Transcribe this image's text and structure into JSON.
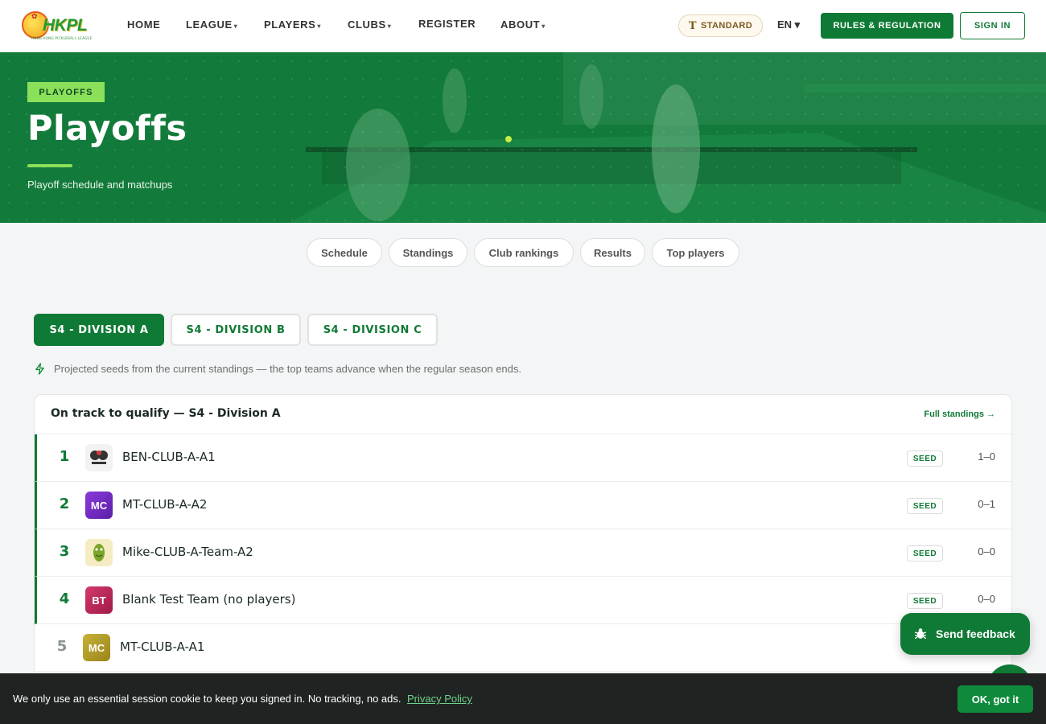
{
  "header": {
    "logo_text": "HKPL",
    "logo_sub": "HONG KONG PICKLEBALL LEAGUE",
    "nav": [
      {
        "label": "HOME",
        "caret": ""
      },
      {
        "label": "LEAGUE",
        "caret": "▾"
      },
      {
        "label": "PLAYERS",
        "caret": "▾"
      },
      {
        "label": "CLUBS",
        "caret": "▾"
      },
      {
        "label": "REGISTER",
        "caret": ""
      },
      {
        "label": "ABOUT",
        "caret": "▾"
      }
    ],
    "mode_label": "STANDARD",
    "lang_label": "EN ▾",
    "rules_label": "RULES & REGULATION",
    "signin_label": "SIGN IN"
  },
  "hero": {
    "tag": "PLAYOFFS",
    "title": "Playoffs",
    "subtitle": "Playoff schedule and matchups"
  },
  "subtabs": [
    "Schedule",
    "Standings",
    "Club rankings",
    "Results",
    "Top players"
  ],
  "divisions": [
    "S4 - DIVISION A",
    "S4 - DIVISION B",
    "S4 - DIVISION C"
  ],
  "note": "Projected seeds from the current standings — the top teams advance when the regular season ends.",
  "card": {
    "title": "On track to qualify — S4 - Division A",
    "link": "Full standings →",
    "rows": [
      {
        "rank": "1",
        "avatar": "",
        "avatar_color": "#f2f2f2",
        "team": "BEN-CLUB-A-A1",
        "seed": "SEED",
        "record": "1–0"
      },
      {
        "rank": "2",
        "avatar": "MC",
        "avatar_color": "#7b2fc9",
        "team": "MT-CLUB-A-A2",
        "seed": "SEED",
        "record": "0–1"
      },
      {
        "rank": "3",
        "avatar": "",
        "avatar_color": "#f5ecc4",
        "team": "Mike-CLUB-A-Team-A2",
        "seed": "SEED",
        "record": "0–0"
      },
      {
        "rank": "4",
        "avatar": "BT",
        "avatar_color": "#b8285a",
        "team": "Blank Test Team (no players)",
        "seed": "SEED",
        "record": "0–0"
      },
      {
        "rank": "5",
        "avatar": "MC",
        "avatar_color": "#b8a22a",
        "team": "MT-CLUB-A-A1",
        "seed": "",
        "record": ""
      }
    ]
  },
  "feedback_label": "Send feedback",
  "cookie": {
    "text": "We only use an essential session cookie to keep you signed in. No tracking, no ads.",
    "link": "Privacy Policy",
    "button": "OK, got it"
  },
  "colors": {
    "brand": "#0f7a35",
    "accent": "#8be05a"
  }
}
